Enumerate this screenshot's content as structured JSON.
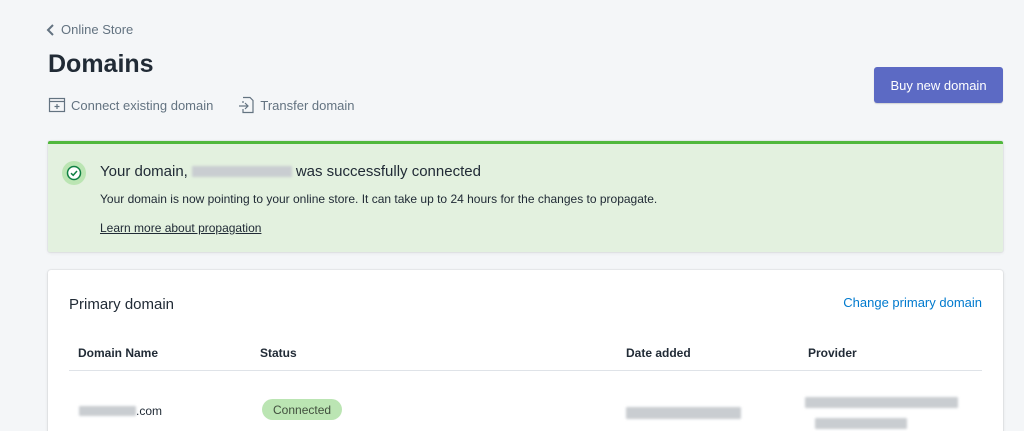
{
  "breadcrumb": {
    "label": "Online Store"
  },
  "page": {
    "title": "Domains"
  },
  "actions": {
    "connect_label": "Connect existing domain",
    "transfer_label": "Transfer domain"
  },
  "primary_button": {
    "label": "Buy new domain"
  },
  "banner": {
    "title_prefix": "Your domain,",
    "title_suffix": "was successfully connected",
    "body": "Your domain is now pointing to your online store. It can take up to 24 hours for the changes to propagate.",
    "link_label": "Learn more about propagation"
  },
  "primary_domain": {
    "title": "Primary domain",
    "change_link": "Change primary domain",
    "columns": [
      "Domain Name",
      "Status",
      "Date added",
      "Provider"
    ],
    "rows": [
      {
        "domain_suffix": ".com",
        "status": "Connected"
      }
    ]
  },
  "colors": {
    "accent": "#5c6ac4",
    "success_border": "#50b83c",
    "success_bg": "#e3f1df",
    "link": "#007ace",
    "badge_bg": "#bbe5b3"
  }
}
